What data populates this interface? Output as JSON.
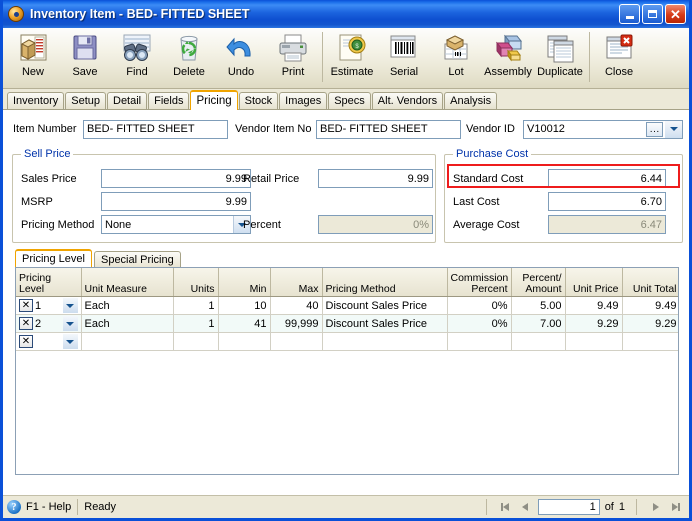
{
  "window": {
    "title_main": "Inventory Item",
    "title_sep": "-",
    "title_item": "BED- FITTED SHEET",
    "icon": "inventory-orb-icon",
    "minimize": "_",
    "maximize": "□",
    "close": "✕"
  },
  "toolbar": {
    "buttons": [
      {
        "label": "New",
        "icon": "new-item-icon"
      },
      {
        "label": "Save",
        "icon": "floppy-disk-icon"
      },
      {
        "label": "Find",
        "icon": "binoculars-icon"
      },
      {
        "label": "Delete",
        "icon": "recycle-bin-icon"
      },
      {
        "label": "Undo",
        "icon": "undo-arrow-icon"
      },
      {
        "label": "Print",
        "icon": "printer-icon"
      },
      {
        "label": "Estimate",
        "icon": "estimate-seal-icon"
      },
      {
        "label": "Serial",
        "icon": "barcode-icon"
      },
      {
        "label": "Lot",
        "icon": "lot-box-icon"
      },
      {
        "label": "Assembly",
        "icon": "assembly-blocks-icon"
      },
      {
        "label": "Duplicate",
        "icon": "duplicate-pages-icon"
      },
      {
        "label": "Close",
        "icon": "close-window-icon"
      }
    ]
  },
  "tabs": {
    "items": [
      "Inventory",
      "Setup",
      "Detail",
      "Fields",
      "Pricing",
      "Stock",
      "Images",
      "Specs",
      "Alt. Vendors",
      "Analysis"
    ],
    "active": "Pricing"
  },
  "header_fields": {
    "item_number_label": "Item Number",
    "item_number_value": "BED- FITTED SHEET",
    "vendor_item_no_label": "Vendor Item No",
    "vendor_item_no_value": "BED- FITTED SHEET",
    "vendor_id_label": "Vendor ID",
    "vendor_id_value": "V10012",
    "vendor_lookup_icon": "ellipsis-lookup-icon",
    "vendor_dropdown_icon": "chevron-down-icon"
  },
  "sell_price": {
    "legend": "Sell Price",
    "sales_price_label": "Sales Price",
    "sales_price_value": "9.99",
    "msrp_label": "MSRP",
    "msrp_value": "9.99",
    "pricing_method_label": "Pricing Method",
    "pricing_method_value": "None",
    "pricing_method_options": [
      "None"
    ],
    "retail_price_label": "Retail Price",
    "retail_price_value": "9.99",
    "percent_label": "Percent",
    "percent_value": "0%"
  },
  "purchase_cost": {
    "legend": "Purchase Cost",
    "standard_cost_label": "Standard Cost",
    "standard_cost_value": "6.44",
    "last_cost_label": "Last Cost",
    "last_cost_value": "6.70",
    "average_cost_label": "Average Cost",
    "average_cost_value": "6.47",
    "highlight_color": "#ee1c1c"
  },
  "pricing_tabs": {
    "items": [
      "Pricing Level",
      "Special Pricing"
    ],
    "active": "Pricing Level"
  },
  "grid": {
    "columns": [
      "Pricing Level",
      "Unit Measure",
      "Units",
      "Min",
      "Max",
      "Pricing Method",
      "Commission Percent",
      "Percent/ Amount",
      "Unit Price",
      "Unit Total"
    ],
    "rows": [
      {
        "delete_icon": "x-delete-icon",
        "level": "1",
        "unit_measure": "Each",
        "units": "1",
        "min": "10",
        "max": "40",
        "pricing_method": "Discount Sales Price",
        "commission_percent": "0%",
        "percent_amount": "5.00",
        "unit_price": "9.49",
        "unit_total": "9.49"
      },
      {
        "delete_icon": "x-delete-icon",
        "level": "2",
        "unit_measure": "Each",
        "units": "1",
        "min": "41",
        "max": "99,999",
        "pricing_method": "Discount Sales Price",
        "commission_percent": "0%",
        "percent_amount": "7.00",
        "unit_price": "9.29",
        "unit_total": "9.29"
      },
      {
        "delete_icon": "x-delete-icon",
        "level": "",
        "unit_measure": "",
        "units": "",
        "min": "",
        "max": "",
        "pricing_method": "",
        "commission_percent": "",
        "percent_amount": "",
        "unit_price": "",
        "unit_total": ""
      }
    ]
  },
  "status": {
    "help_icon": "help-question-icon",
    "help_label": "F1 - Help",
    "state": "Ready",
    "first_icon": "first-record-icon",
    "prev_icon": "previous-record-icon",
    "page_value": "1",
    "of_label": "of",
    "page_count": "1",
    "next_icon": "next-record-icon",
    "last_icon": "last-record-icon"
  }
}
